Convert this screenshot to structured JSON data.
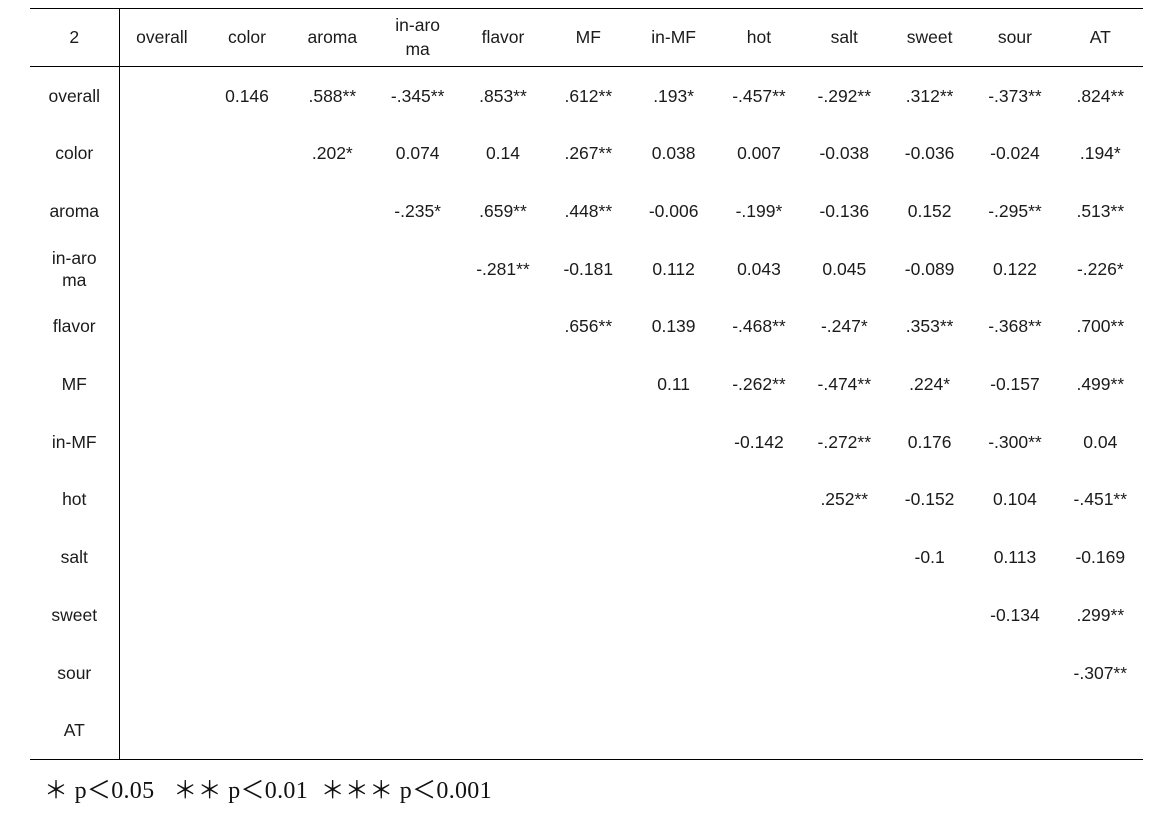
{
  "table": {
    "corner_label": "2",
    "columns": [
      "overall",
      "color",
      "aroma",
      "in-aro\nma",
      "flavor",
      "MF",
      "in-MF",
      "hot",
      "salt",
      "sweet",
      "sour",
      "AT"
    ],
    "row_labels": [
      "overall",
      "color",
      "aroma",
      "in-aro\nma",
      "flavor",
      "MF",
      "in-MF",
      "hot",
      "salt",
      "sweet",
      "sour",
      "AT"
    ],
    "rows": [
      {
        "label": "overall",
        "cells": [
          "",
          "0.146",
          ".588**",
          "-.345**",
          ".853**",
          ".612**",
          ".193*",
          "-.457**",
          "-.292**",
          ".312**",
          "-.373**",
          ".824**"
        ]
      },
      {
        "label": "color",
        "cells": [
          "",
          "",
          ".202*",
          "0.074",
          "0.14",
          ".267**",
          "0.038",
          "0.007",
          "-0.038",
          "-0.036",
          "-0.024",
          ".194*"
        ]
      },
      {
        "label": "aroma",
        "cells": [
          "",
          "",
          "",
          "-.235*",
          ".659**",
          ".448**",
          "-0.006",
          "-.199*",
          "-0.136",
          "0.152",
          "-.295**",
          ".513**"
        ]
      },
      {
        "label": "in-aro\nma",
        "cells": [
          "",
          "",
          "",
          "",
          "-.281**",
          "-0.181",
          "0.112",
          "0.043",
          "0.045",
          "-0.089",
          "0.122",
          "-.226*"
        ]
      },
      {
        "label": "flavor",
        "cells": [
          "",
          "",
          "",
          "",
          "",
          ".656**",
          "0.139",
          "-.468**",
          "-.247*",
          ".353**",
          "-.368**",
          ".700**"
        ]
      },
      {
        "label": "MF",
        "cells": [
          "",
          "",
          "",
          "",
          "",
          "",
          "0.11",
          "-.262**",
          "-.474**",
          ".224*",
          "-0.157",
          ".499**"
        ]
      },
      {
        "label": "in-MF",
        "cells": [
          "",
          "",
          "",
          "",
          "",
          "",
          "",
          "-0.142",
          "-.272**",
          "0.176",
          "-.300**",
          "0.04"
        ]
      },
      {
        "label": "hot",
        "cells": [
          "",
          "",
          "",
          "",
          "",
          "",
          "",
          "",
          ".252**",
          "-0.152",
          "0.104",
          "-.451**"
        ]
      },
      {
        "label": "salt",
        "cells": [
          "",
          "",
          "",
          "",
          "",
          "",
          "",
          "",
          "",
          "-0.1",
          "0.113",
          "-0.169"
        ]
      },
      {
        "label": "sweet",
        "cells": [
          "",
          "",
          "",
          "",
          "",
          "",
          "",
          "",
          "",
          "",
          "-0.134",
          ".299**"
        ]
      },
      {
        "label": "sour",
        "cells": [
          "",
          "",
          "",
          "",
          "",
          "",
          "",
          "",
          "",
          "",
          "",
          "-.307**"
        ]
      },
      {
        "label": "AT",
        "cells": [
          "",
          "",
          "",
          "",
          "",
          "",
          "",
          "",
          "",
          "",
          "",
          ""
        ]
      }
    ]
  },
  "footnote": {
    "text": "＊ p＜0.05   ＊＊ p＜0.01  ＊＊＊ p＜0.001"
  }
}
